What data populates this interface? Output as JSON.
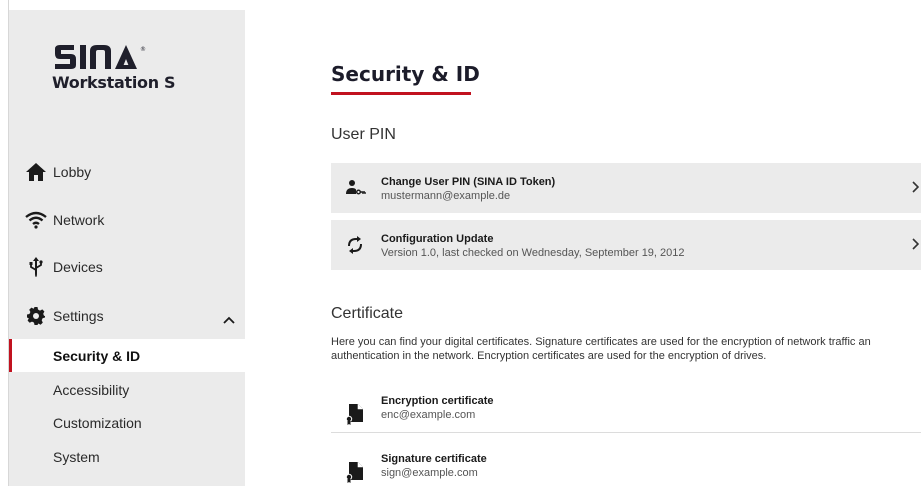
{
  "brand": {
    "logo_text": "SINA",
    "product_name": "Workstation S"
  },
  "sidebar": {
    "items": [
      {
        "label": "Lobby",
        "icon": "home-icon"
      },
      {
        "label": "Network",
        "icon": "wifi-icon"
      },
      {
        "label": "Devices",
        "icon": "usb-icon"
      },
      {
        "label": "Settings",
        "icon": "gear-icon",
        "expanded": true
      }
    ],
    "settings_children": [
      {
        "label": "Security & ID",
        "active": true
      },
      {
        "label": "Accessibility"
      },
      {
        "label": "Customization"
      },
      {
        "label": "System"
      }
    ]
  },
  "main": {
    "title": "Security & ID",
    "user_pin_section": {
      "heading": "User PIN",
      "cards": [
        {
          "title": "Change User PIN (SINA ID Token)",
          "subtitle": "mustermann@example.de",
          "icon": "user-key-icon"
        },
        {
          "title": "Configuration Update",
          "subtitle": "Version 1.0, last checked on Wednesday, September 19, 2012",
          "icon": "sync-icon"
        }
      ]
    },
    "certificate_section": {
      "heading": "Certificate",
      "description": "Here you can find your digital certificates. Signature certificates are used for the encryption of network traffic an authentication in the network. Encryption certificates are used for the encryption of drives.",
      "items": [
        {
          "title": "Encryption certificate",
          "subtitle": "enc@example.com",
          "icon": "certificate-icon"
        },
        {
          "title": "Signature certificate",
          "subtitle": "sign@example.com",
          "icon": "certificate-icon"
        }
      ]
    }
  },
  "colors": {
    "accent": "#c1121f",
    "sidebar_bg": "#ebebeb",
    "card_bg": "#ebebeb"
  }
}
